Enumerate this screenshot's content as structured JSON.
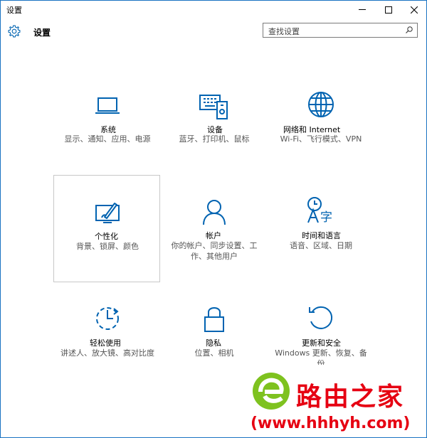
{
  "window": {
    "title": "设置"
  },
  "header": {
    "title": "设置",
    "search_placeholder": "查找设置"
  },
  "tiles": [
    {
      "label": "系统",
      "desc": "显示、通知、应用、电源",
      "icon": "laptop-icon"
    },
    {
      "label": "设备",
      "desc": "蓝牙、打印机、鼠标",
      "icon": "devices-icon"
    },
    {
      "label": "网络和 Internet",
      "desc": "Wi-Fi、飞行模式、VPN",
      "icon": "globe-icon"
    },
    {
      "label": "个性化",
      "desc": "背景、锁屏、颜色",
      "icon": "personalization-icon"
    },
    {
      "label": "帐户",
      "desc": "你的帐户、同步设置、工作、其他用户",
      "icon": "person-icon"
    },
    {
      "label": "时间和语言",
      "desc": "语音、区域、日期",
      "icon": "time-language-icon"
    },
    {
      "label": "轻松使用",
      "desc": "讲述人、放大镜、高对比度",
      "icon": "ease-of-access-icon"
    },
    {
      "label": "隐私",
      "desc": "位置、相机",
      "icon": "lock-icon"
    },
    {
      "label": "更新和安全",
      "desc": "Windows 更新、恢复、备份",
      "icon": "update-icon"
    }
  ],
  "watermark": {
    "brand": "路由之家",
    "url": "(www.hhhyh.com)"
  },
  "colors": {
    "accent": "#0063b1",
    "window_border": "#1a73c2",
    "watermark": "#e60012"
  }
}
